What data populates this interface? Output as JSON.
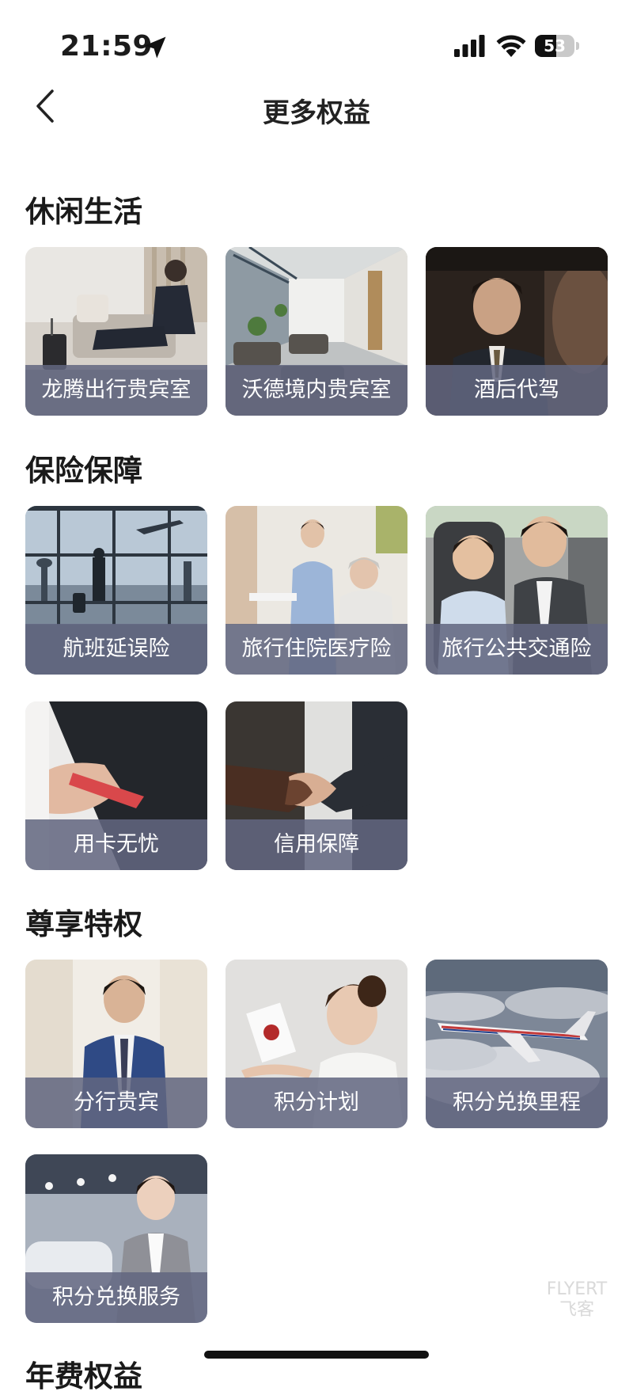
{
  "status_bar": {
    "time": "21:59",
    "battery": "53",
    "battery_level": 0.53,
    "icons": [
      "location-arrow-icon",
      "cellular-signal-icon",
      "wifi-icon",
      "battery-icon"
    ]
  },
  "nav": {
    "title": "更多权益",
    "back_icon": "chevron-left-icon"
  },
  "sections": [
    {
      "title": "休闲生活",
      "items": [
        {
          "label": "龙腾出行贵宾室",
          "image": "business-traveler-lounge-photo"
        },
        {
          "label": "沃德境内贵宾室",
          "image": "airport-lounge-photo"
        },
        {
          "label": "酒后代驾",
          "image": "chauffeur-driver-photo"
        }
      ]
    },
    {
      "title": "保险保障",
      "items": [
        {
          "label": "航班延误险",
          "image": "airport-window-plane-photo"
        },
        {
          "label": "旅行住院医疗险",
          "image": "nurse-elderly-patient-photo"
        },
        {
          "label": "旅行公共交通险",
          "image": "father-child-car-photo"
        },
        {
          "label": "用卡无忧",
          "image": "hand-holding-card-photo"
        },
        {
          "label": "信用保障",
          "image": "handshake-photo"
        }
      ]
    },
    {
      "title": "尊享特权",
      "items": [
        {
          "label": "分行贵宾",
          "image": "businessman-suit-photo"
        },
        {
          "label": "积分计划",
          "image": "woman-with-gift-envelope-photo"
        },
        {
          "label": "积分兑换里程",
          "image": "airplane-above-clouds-photo"
        },
        {
          "label": "积分兑换服务",
          "image": "service-staff-woman-photo"
        }
      ]
    },
    {
      "title": "年费权益"
    }
  ],
  "watermark": {
    "line1": "FLYERT",
    "line2": "飞客"
  },
  "colors": {
    "label_overlay": "#626680",
    "background": "#ffffff",
    "title_text": "#1a1a1a"
  }
}
